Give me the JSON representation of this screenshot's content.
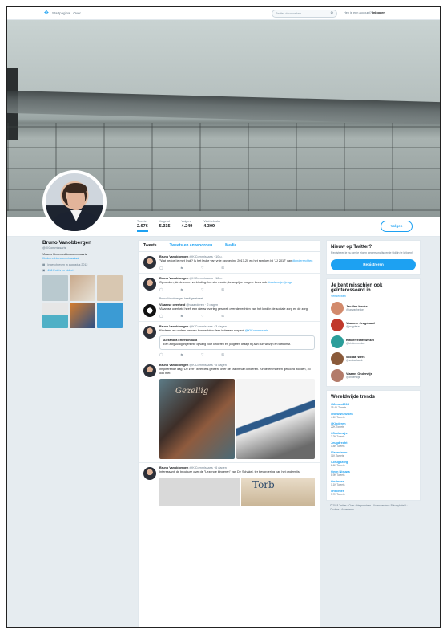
{
  "nav": {
    "home": "Startpagina",
    "about": "Over",
    "search_placeholder": "Twitter doorzoeken",
    "account_prompt": "Heb je een account?",
    "login": "Inloggen"
  },
  "profile": {
    "stats": [
      {
        "label": "Tweets",
        "value": "2.676"
      },
      {
        "label": "Volgend",
        "value": "5.315"
      },
      {
        "label": "Volgers",
        "value": "4.249"
      },
      {
        "label": "Vind-ik-leuks",
        "value": "4.309"
      }
    ],
    "follow": "Volgen",
    "name": "Bruno Vanobbergen",
    "handle": "@KICommissaris",
    "bio": "Vlaams Kinderrechtencommissaris",
    "bio_link": "Kinderrechtencommissariaat",
    "location": "Ingeschreven in augustus 2012",
    "photos_link": "436 Foto's en video's"
  },
  "tabs": [
    "Tweets",
    "Tweets en antwoorden",
    "Media"
  ],
  "tweets": [
    {
      "name": "Bruno Vanobbergen",
      "meta": "@KICommissaris · 10 u.",
      "text": "\"Wat bedoel je met leuk? Is het leuke van vrije opvoeding 2017-20 en het spreken bij 'JJ 2017' van",
      "link": "#kinderrechten"
    },
    {
      "name": "Bruno Vanobbergen",
      "meta": "@KICommissaris · 18 u.",
      "text": "Opvoeden, kinderen en verbinding: het zijn mooie, belangrijke vragen. Lees ook",
      "link": "#onderwijs #jeugd"
    },
    {
      "pinned": "Bruno Vanobbergen heeft geretweet",
      "name": "Vlaamse overheid",
      "meta": "@vlaanderen · 2 dagen",
      "text": "Vlaamse overheid heeft een nieuw overleg gesprek over de rechten van het kind in de sociale zorg en de zorg.",
      "link": ""
    },
    {
      "name": "Bruno Vanobbergen",
      "meta": "@KICommissaris · 3 dagen",
      "text": "Kinderen en ouders kennen hun rechten: leer iedereen respect",
      "link": "@KICommissaris",
      "quote_name": "Alexandra Emersonduca",
      "quote_text": "Een zorgvuldig ingerichte opvang voor kinderen en jongeren draagt bij aan hun welzijn en toekomst."
    },
    {
      "name": "Bruno Vanobbergen",
      "meta": "@KICommissaris · 5 dagen",
      "text": "Inspirerende dag \"De zelf\": weer iets geleerd over de kracht van kinderen. Kinderen moeten gehoord worden, zo ook hier.",
      "img_text": "Gezellig"
    },
    {
      "name": "Bruno Vanobbergen",
      "meta": "@KICommissaris · 6 dagen",
      "text": "Interessant: de brochure over de \"Lezende kinderen\" van De Schakel, ter bevordering van het onderwijs.",
      "img_text": "Torb"
    }
  ],
  "side": {
    "signup_title": "Nieuw op Twitter?",
    "signup_sub": "Registreer je nu om je eigen gepersonaliseerde tijdlijn te krijgen!",
    "signup_btn": "Registreren",
    "suggest_title": "Je bent misschien ook geïnteresseerd in",
    "suggest_sub": "Vernieuwen",
    "suggestions": [
      {
        "name": "Jan Van Hecke",
        "handle": "@janvanhecke",
        "color": "#d28a6c"
      },
      {
        "name": "Vlaamse Jeugdraad",
        "handle": "@jeugdraad",
        "color": "#c0392b"
      },
      {
        "name": "Kinderrechtswinkel",
        "handle": "@kinderrechten",
        "color": "#2c9e9a"
      },
      {
        "name": "Sociaal Werk",
        "handle": "@sociaalwerk",
        "color": "#8a5a3a"
      },
      {
        "name": "Vlaams Onderwijs",
        "handle": "@onderwijs",
        "color": "#b37b6a"
      }
    ],
    "trends_title": "Wereldwijde trends",
    "trends": [
      {
        "tag": "#Mondo2018",
        "count": "15.4K Tweets"
      },
      {
        "tag": "#NieuwSeizoen",
        "count": "4.1K Tweets"
      },
      {
        "tag": "#Kinderen",
        "count": "22K Tweets"
      },
      {
        "tag": "#Onderwijs",
        "count": "3.2K Tweets"
      },
      {
        "tag": "Jeugdrecht",
        "count": "1.8K Tweets"
      },
      {
        "tag": "Vlaanderen",
        "count": "11K Tweets"
      },
      {
        "tag": "#Jeugdzorg",
        "count": "2.6K Tweets"
      },
      {
        "tag": "Geen Nieuws",
        "count": "8.9K Tweets"
      },
      {
        "tag": "Gezinnen",
        "count": "1.1K Tweets"
      },
      {
        "tag": "#Rechten",
        "count": "5.7K Tweets"
      }
    ],
    "footer": "© 2018 Twitter · Over · Helpcentrum · Voorwaarden · Privacybeleid · Cookies · Adverteren"
  }
}
